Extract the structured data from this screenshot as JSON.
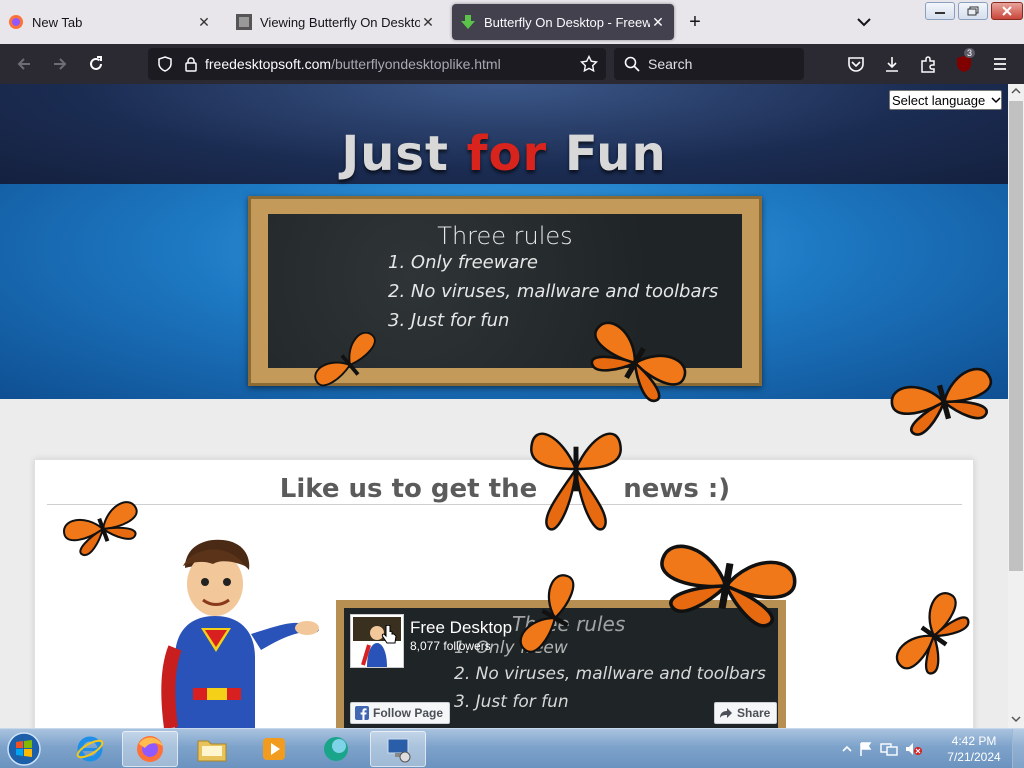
{
  "browser": {
    "tabs": [
      {
        "title": "New Tab",
        "active": false
      },
      {
        "title": "Viewing Butterfly On Desktop w",
        "active": false
      },
      {
        "title": "Butterfly On Desktop - Freewar",
        "active": true
      }
    ],
    "url_host": "freedesktopsoft.com",
    "url_path": "/butterflyondesktoplike.html",
    "search_placeholder": "Search",
    "extension_badge": "3"
  },
  "page": {
    "language_select": "Select language",
    "hero": {
      "part1": "Just ",
      "part2": "for",
      "part3": " Fun"
    },
    "chalkboard": {
      "title": "Three rules",
      "rules": [
        "1. Only freeware",
        "2. No viruses, mallware and toolbars",
        "3. Just for fun"
      ]
    },
    "like_title": "Like us to get the",
    "like_title_end": "news :)",
    "facebook": {
      "page_name": "Free Desktop",
      "followers": "8,077 followers",
      "follow_label": "Follow Page",
      "share_label": "Share",
      "bg_title": "Three rules",
      "bg_rules": [
        "1. Only freew",
        "2. No viruses, mallware and toolbars",
        "3. Just for fun"
      ]
    }
  },
  "taskbar": {
    "time": "4:42 PM",
    "date": "7/21/2024"
  }
}
